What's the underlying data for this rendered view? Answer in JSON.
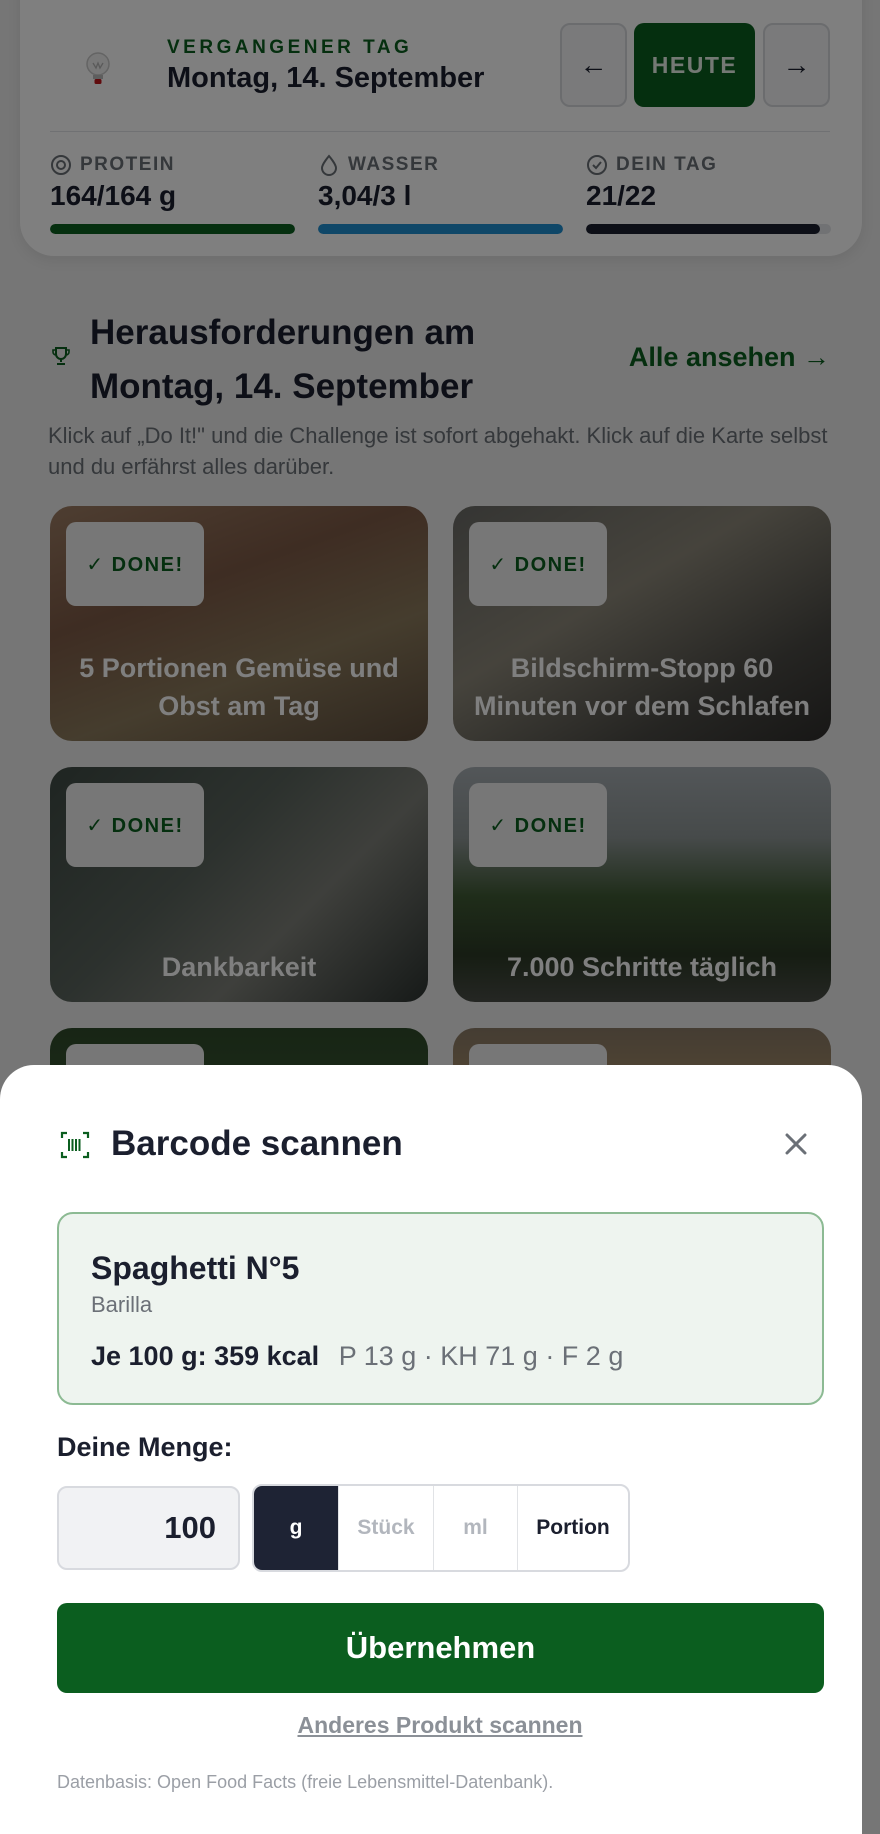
{
  "header": {
    "past_day_label": "VERGANGENER TAG",
    "date": "Montag, 14. September",
    "prev_label": "←",
    "today_label": "HEUTE",
    "next_label": "→"
  },
  "metrics": [
    {
      "label": "PROTEIN",
      "value": "164/164 g",
      "progress": 1.0,
      "color": "#0b5e1f",
      "icon": "target-icon"
    },
    {
      "label": "WASSER",
      "value": "3,04/3 l",
      "progress": 1.0,
      "color": "#1f8fd1",
      "icon": "water-drop-icon"
    },
    {
      "label": "DEIN TAG",
      "value": "21/22",
      "progress": 0.955,
      "color": "#1b1f2e",
      "icon": "check-circle-icon"
    }
  ],
  "challenges": {
    "title": "Herausforderungen am Montag, 14. September",
    "see_all": "Alle ansehen →",
    "description": "Klick auf „Do It!\" und die Challenge ist sofort abgehakt. Klick auf die Karte selbst und du erfährst alles darüber.",
    "cards": [
      {
        "badge": "✓ DONE!",
        "title": "5 Portionen Gemüse und Obst am Tag"
      },
      {
        "badge": "✓ DONE!",
        "title": "Bildschirm-Stopp 60 Minuten vor dem Schlafen"
      },
      {
        "badge": "✓ DONE!",
        "title": "Dankbarkeit"
      },
      {
        "badge": "✓ DONE!",
        "title": "7.000 Schritte täglich"
      }
    ]
  },
  "sheet": {
    "title": "Barcode scannen",
    "product": {
      "name": "Spaghetti N°5",
      "brand": "Barilla",
      "per100": "Je 100 g: 359 kcal",
      "macros": "P 13 g · KH 71 g · F 2 g"
    },
    "quantity_label": "Deine Menge:",
    "quantity_value": "100",
    "units": [
      "g",
      "Stück",
      "ml",
      "Portion"
    ],
    "selected_unit": "g",
    "apply_label": "Übernehmen",
    "other_product_label": "Anderes Produkt scannen",
    "footnote": "Datenbasis: Open Food Facts (freie Lebensmittel-Datenbank)."
  },
  "colors": {
    "brand_green": "#0b5e1f",
    "water_blue": "#1f8fd1",
    "dark": "#1b1f2e"
  }
}
